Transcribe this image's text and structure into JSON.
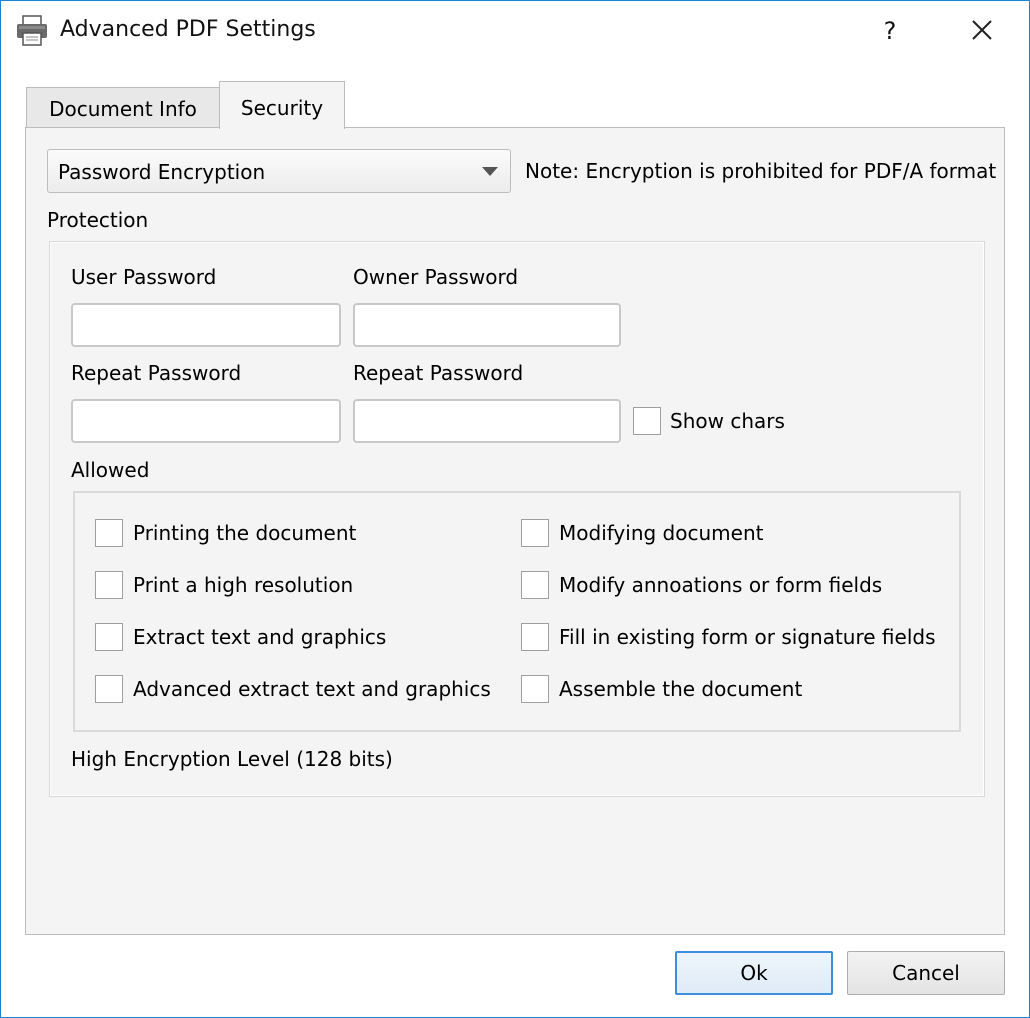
{
  "window": {
    "title": "Advanced PDF Settings",
    "help_label": "?"
  },
  "tabs": [
    {
      "label": "Document Info",
      "active": false
    },
    {
      "label": "Security",
      "active": true
    }
  ],
  "security": {
    "encryption_select": {
      "value": "Password Encryption"
    },
    "note": "Note: Encryption is prohibited for PDF/A format",
    "protection_label": "Protection",
    "user_password": {
      "label": "User Password",
      "value": ""
    },
    "owner_password": {
      "label": "Owner Password",
      "value": ""
    },
    "user_repeat": {
      "label": "Repeat Password",
      "value": ""
    },
    "owner_repeat": {
      "label": "Repeat Password",
      "value": ""
    },
    "show_chars": {
      "label": "Show chars",
      "checked": false
    },
    "allowed_label": "Allowed",
    "permissions": [
      {
        "label": "Printing the document",
        "checked": false
      },
      {
        "label": "Print a high resolution",
        "checked": false
      },
      {
        "label": "Extract text and graphics",
        "checked": false
      },
      {
        "label": "Advanced extract text and graphics",
        "checked": false
      },
      {
        "label": "Modifying document",
        "checked": false
      },
      {
        "label": "Modify annoations or form fields",
        "checked": false
      },
      {
        "label": "Fill in existing form or signature fields",
        "checked": false
      },
      {
        "label": "Assemble the document",
        "checked": false
      }
    ],
    "encryption_level": "High Encryption Level (128 bits)"
  },
  "footer": {
    "ok_label": "Ok",
    "cancel_label": "Cancel"
  },
  "colors": {
    "window_border": "#1883d7",
    "panel_bg": "#f4f4f4",
    "ok_border": "#3d8ee0"
  }
}
